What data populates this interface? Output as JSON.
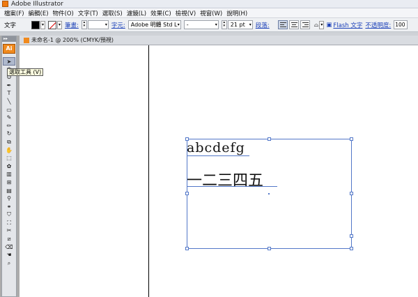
{
  "window": {
    "title": "Adobe Illustrator"
  },
  "menu": [
    "檔案(F)",
    "編輯(E)",
    "物件(O)",
    "文字(T)",
    "選取(S)",
    "濾鏡(L)",
    "效果(C)",
    "檢視(V)",
    "視窗(W)",
    "說明(H)"
  ],
  "control_bar": {
    "tool_label": "文字",
    "stroke_label": "筆畫:",
    "character_label": "字元:",
    "font_family": "Adobe 明體 Std L",
    "font_style": "-",
    "font_size": "21 pt",
    "paragraph_label": "段落:",
    "flash_text_label": "Flash 文字",
    "opacity_label": "不透明度:",
    "opacity_value": "100",
    "colors": {
      "fill": "#000000",
      "stroke": "none"
    }
  },
  "tools": {
    "tooltip": "選取工具 (V)",
    "logo": "Ai",
    "collapse": "▸▸",
    "list": [
      {
        "name": "selection-tool-icon",
        "glyph": "➤"
      },
      {
        "name": "magic-wand-tool-icon",
        "glyph": "✲"
      },
      {
        "name": "lasso-tool-icon",
        "glyph": "ʘ"
      },
      {
        "name": "pen-tool-icon",
        "glyph": "✒"
      },
      {
        "name": "type-tool-icon",
        "glyph": "T"
      },
      {
        "name": "line-tool-icon",
        "glyph": "╲"
      },
      {
        "name": "rectangle-tool-icon",
        "glyph": "▭"
      },
      {
        "name": "paintbrush-tool-icon",
        "glyph": "✎"
      },
      {
        "name": "pencil-tool-icon",
        "glyph": "✏"
      },
      {
        "name": "rotate-tool-icon",
        "glyph": "↻"
      },
      {
        "name": "scale-tool-icon",
        "glyph": "⧉"
      },
      {
        "name": "warp-tool-icon",
        "glyph": "✋"
      },
      {
        "name": "free-transform-tool-icon",
        "glyph": "⬚"
      },
      {
        "name": "symbol-sprayer-tool-icon",
        "glyph": "✿"
      },
      {
        "name": "column-graph-tool-icon",
        "glyph": "▥"
      },
      {
        "name": "mesh-tool-icon",
        "glyph": "⊞"
      },
      {
        "name": "gradient-tool-icon",
        "glyph": "▤"
      },
      {
        "name": "eyedropper-tool-icon",
        "glyph": "⚲"
      },
      {
        "name": "blend-tool-icon",
        "glyph": "⚭"
      },
      {
        "name": "live-paint-tool-icon",
        "glyph": "⛉"
      },
      {
        "name": "live-paint-selection-tool-icon",
        "glyph": "⛶"
      },
      {
        "name": "crop-area-tool-icon",
        "glyph": "✂"
      },
      {
        "name": "slice-tool-icon",
        "glyph": "⧄"
      },
      {
        "name": "eraser-tool-icon",
        "glyph": "⌫"
      },
      {
        "name": "hand-tool-icon",
        "glyph": "☚"
      },
      {
        "name": "zoom-tool-icon",
        "glyph": "⌕"
      }
    ]
  },
  "document": {
    "tab_title": "未命名-1 @ 200% (CMYK/預視)",
    "text_line1": "abcdefg",
    "text_line2": "一二三四五"
  }
}
